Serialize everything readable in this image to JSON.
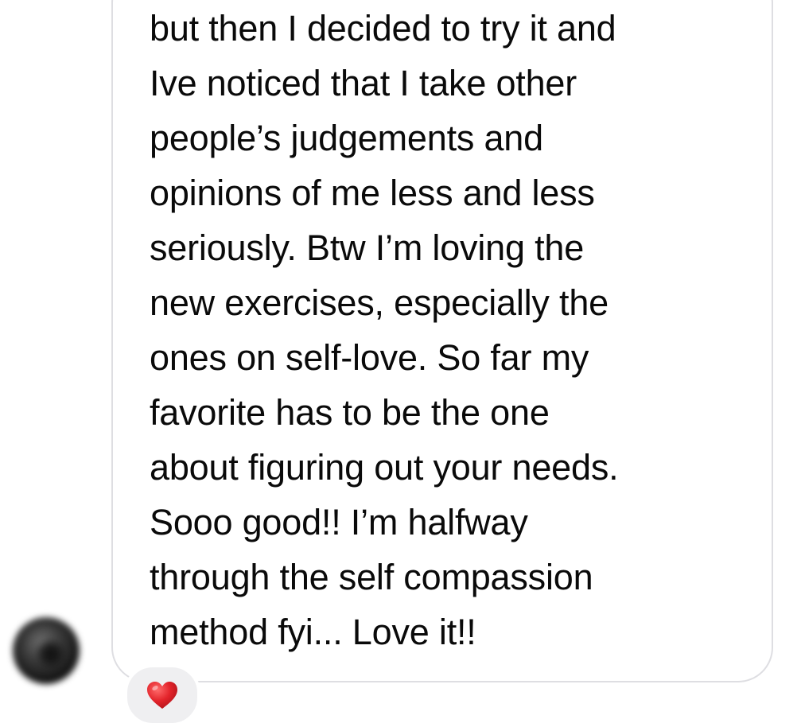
{
  "message": {
    "lines": [
      "but then I decided to try it and",
      "Ive noticed that I take other",
      "people’s judgements and",
      "opinions of me less and less",
      "seriously. Btw I’m loving the",
      "new exercises, especially the",
      "ones on self-love. So far my",
      "favorite has to be the one",
      "about figuring out your needs.",
      "Sooo good!! I’m halfway",
      "through the self compassion",
      "method fyi... Love it!!"
    ]
  },
  "reaction": {
    "emoji": "heart",
    "color": "#e3242b"
  },
  "colors": {
    "bubble_border": "#dedee2",
    "reaction_background": "#efeff1",
    "text": "#0a0a0a"
  }
}
